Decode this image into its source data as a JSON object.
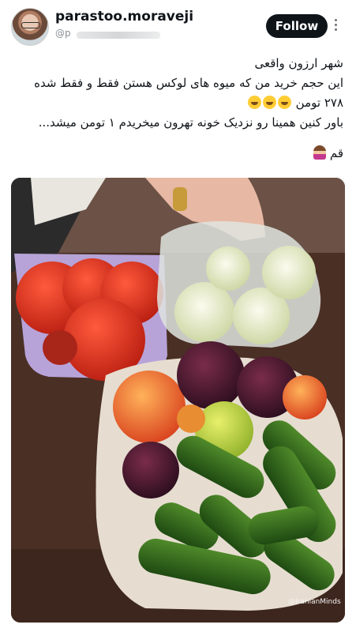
{
  "post": {
    "username": "parastoo.moraveji",
    "handle": "@p",
    "follow_label": "Follow",
    "lines": [
      "شهر ارزون واقعی",
      "این حجم خرید من که میوه های لوکس هستن فقط و فقط شده",
      "۲۷۸ تومن",
      "باور کنین همینا رو نزدیک خونه تهرون میخریدم ۱ تومن میشد..."
    ],
    "last_line": "قم"
  },
  "photo": {
    "watermark": "@IranianMinds"
  },
  "icons": {
    "more": "more-vertical-icon",
    "laughing_emoji": "laughing-emoji-icon",
    "woman_emoji": "woman-facepalm-emoji-icon"
  },
  "colors": {
    "follow_bg": "#0f1419",
    "text": "#0f1419",
    "handle": "#8a8f95"
  }
}
